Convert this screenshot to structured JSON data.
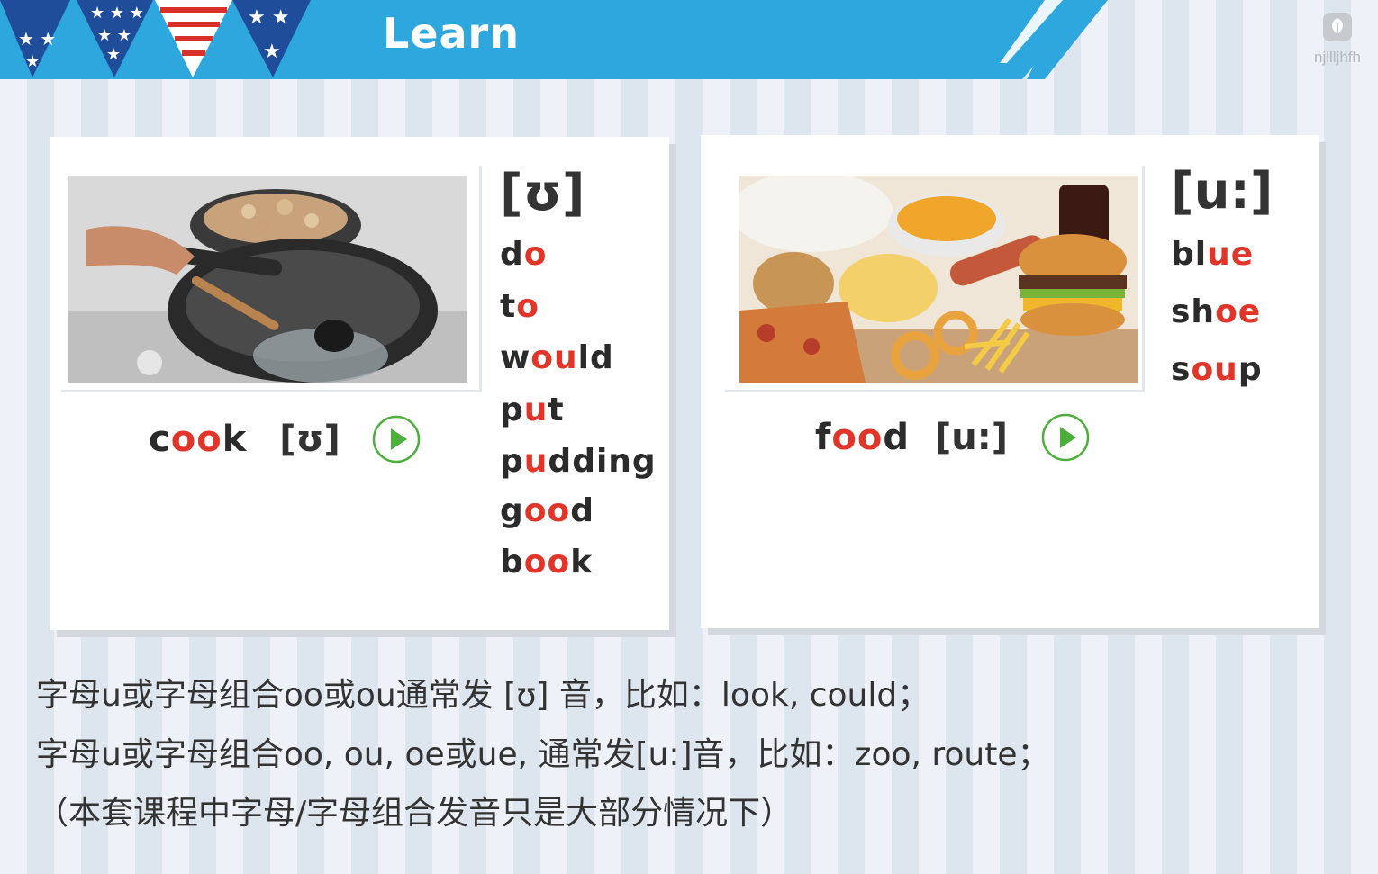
{
  "header": {
    "title": "Learn",
    "logo_text": "njllljhfh"
  },
  "left_card": {
    "word_parts": [
      {
        "t": "c",
        "hl": false
      },
      {
        "t": "oo",
        "hl": true
      },
      {
        "t": "k",
        "hl": false
      }
    ],
    "ipa": "[ʊ]",
    "list_heading": "[ʊ]",
    "words": [
      [
        {
          "t": "d",
          "hl": false
        },
        {
          "t": "o",
          "hl": true
        }
      ],
      [
        {
          "t": "t",
          "hl": false
        },
        {
          "t": "o",
          "hl": true
        }
      ],
      [
        {
          "t": "w",
          "hl": false
        },
        {
          "t": "ou",
          "hl": true
        },
        {
          "t": "ld",
          "hl": false
        }
      ],
      [
        {
          "t": "p",
          "hl": false
        },
        {
          "t": "u",
          "hl": true
        },
        {
          "t": "t",
          "hl": false
        }
      ],
      [
        {
          "t": "p",
          "hl": false
        },
        {
          "t": "u",
          "hl": true
        },
        {
          "t": "dding",
          "hl": false
        }
      ],
      [
        {
          "t": "g",
          "hl": false
        },
        {
          "t": "oo",
          "hl": true
        },
        {
          "t": "d",
          "hl": false
        }
      ],
      [
        {
          "t": "b",
          "hl": false
        },
        {
          "t": "oo",
          "hl": true
        },
        {
          "t": "k",
          "hl": false
        }
      ]
    ]
  },
  "right_card": {
    "word_parts": [
      {
        "t": "f",
        "hl": false
      },
      {
        "t": "oo",
        "hl": true
      },
      {
        "t": "d",
        "hl": false
      }
    ],
    "ipa": "[u:]",
    "list_heading": "[u:]",
    "words": [
      [
        {
          "t": "bl",
          "hl": false
        },
        {
          "t": "ue",
          "hl": true
        }
      ],
      [
        {
          "t": "sh",
          "hl": false
        },
        {
          "t": "oe",
          "hl": true
        }
      ],
      [
        {
          "t": "s",
          "hl": false
        },
        {
          "t": "ou",
          "hl": true
        },
        {
          "t": "p",
          "hl": false
        }
      ]
    ]
  },
  "notes": [
    "字母u或字母组合oo或ou通常发 [ʊ] 音，比如：look, could；",
    "字母u或字母组合oo, ou, oe或ue, 通常发[u:]音，比如：zoo, route；",
    "（本套课程中字母/字母组合发音只是大部分情况下）"
  ],
  "colors": {
    "accent_blue": "#2ea7df",
    "highlight": "#e2352a",
    "play_green": "#4caf3a"
  }
}
